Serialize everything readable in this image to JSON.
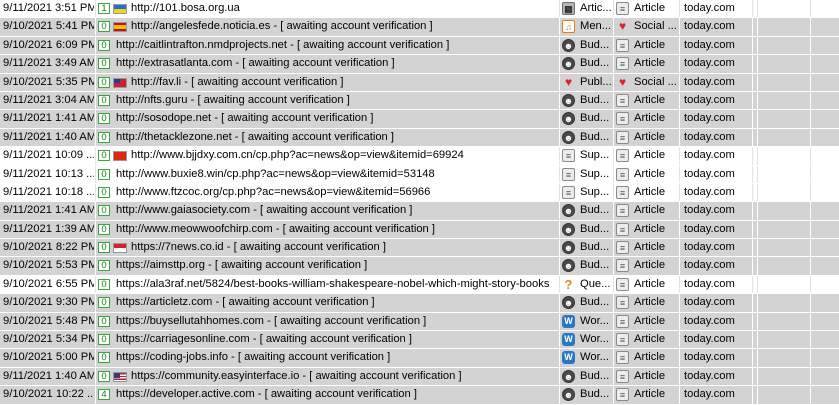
{
  "rows": [
    {
      "date": "9/11/2021 3:51 PM",
      "count": "1",
      "flag": "ua",
      "url": "http://101.bosa.org.ua",
      "topic_icon": "chip-icon",
      "topic": "Artic...",
      "page_icon": "doc-icon",
      "page_type": "Article",
      "site": "today.com",
      "shade": "white"
    },
    {
      "date": "9/10/2021 5:41 PM",
      "count": "0",
      "flag": "es",
      "url": "http://angelesfede.noticia.es - [ awaiting account verification ]",
      "topic_icon": "media-icon",
      "topic": "Men...",
      "page_icon": "social-icon",
      "page_type": "Social ...",
      "site": "today.com",
      "shade": "gray"
    },
    {
      "date": "9/10/2021 6:09 PM",
      "count": "0",
      "flag": "",
      "url": "http://caitlintrafton.nmdprojects.net - [ awaiting account verification ]",
      "topic_icon": "user-icon",
      "topic": "Bud...",
      "page_icon": "doc-icon",
      "page_type": "Article",
      "site": "today.com",
      "shade": "gray"
    },
    {
      "date": "9/11/2021 3:49 AM",
      "count": "0",
      "flag": "",
      "url": "http://extrasatlanta.com - [ awaiting account verification ]",
      "topic_icon": "user-icon",
      "topic": "Bud...",
      "page_icon": "doc-icon",
      "page_type": "Article",
      "site": "today.com",
      "shade": "gray"
    },
    {
      "date": "9/10/2021 5:35 PM",
      "count": "0",
      "flag": "tw",
      "url": "http://fav.li - [ awaiting account verification ]",
      "topic_icon": "heart-icon",
      "topic": "Publ...",
      "page_icon": "social-icon",
      "page_type": "Social ...",
      "site": "today.com",
      "shade": "gray"
    },
    {
      "date": "9/11/2021 3:04 AM",
      "count": "0",
      "flag": "",
      "url": "http://nfts.guru - [ awaiting account verification ]",
      "topic_icon": "user-icon",
      "topic": "Bud...",
      "page_icon": "doc-icon",
      "page_type": "Article",
      "site": "today.com",
      "shade": "gray"
    },
    {
      "date": "9/11/2021 1:41 AM",
      "count": "0",
      "flag": "",
      "url": "http://sosodope.net - [ awaiting account verification ]",
      "topic_icon": "user-icon",
      "topic": "Bud...",
      "page_icon": "doc-icon",
      "page_type": "Article",
      "site": "today.com",
      "shade": "gray"
    },
    {
      "date": "9/11/2021 1:40 AM",
      "count": "0",
      "flag": "",
      "url": "http://thetacklezone.net - [ awaiting account verification ]",
      "topic_icon": "user-icon",
      "topic": "Bud...",
      "page_icon": "doc-icon",
      "page_type": "Article",
      "site": "today.com",
      "shade": "gray"
    },
    {
      "date": "9/11/2021 10:09 ...",
      "count": "0",
      "flag": "cn",
      "url": "http://www.bjjdxy.com.cn/cp.php?ac=news&op=view&itemid=69924",
      "topic_icon": "doc-icon",
      "topic": "Sup...",
      "page_icon": "doc-icon",
      "page_type": "Article",
      "site": "today.com",
      "shade": "white"
    },
    {
      "date": "9/11/2021 10:13 ...",
      "count": "0",
      "flag": "",
      "url": "http://www.buxie8.win/cp.php?ac=news&op=view&itemid=53148",
      "topic_icon": "doc-icon",
      "topic": "Sup...",
      "page_icon": "doc-icon",
      "page_type": "Article",
      "site": "today.com",
      "shade": "white"
    },
    {
      "date": "9/11/2021 10:18 ...",
      "count": "0",
      "flag": "",
      "url": "http://www.ftzcoc.org/cp.php?ac=news&op=view&itemid=56966",
      "topic_icon": "doc-icon",
      "topic": "Sup...",
      "page_icon": "doc-icon",
      "page_type": "Article",
      "site": "today.com",
      "shade": "white"
    },
    {
      "date": "9/11/2021 1:41 AM",
      "count": "0",
      "flag": "",
      "url": "http://www.gaiasociety.com - [ awaiting account verification ]",
      "topic_icon": "user-icon",
      "topic": "Bud...",
      "page_icon": "doc-icon",
      "page_type": "Article",
      "site": "today.com",
      "shade": "gray"
    },
    {
      "date": "9/11/2021 1:39 AM",
      "count": "0",
      "flag": "",
      "url": "http://www.meowwoofchirp.com - [ awaiting account verification ]",
      "topic_icon": "user-icon",
      "topic": "Bud...",
      "page_icon": "doc-icon",
      "page_type": "Article",
      "site": "today.com",
      "shade": "gray"
    },
    {
      "date": "9/10/2021 8:22 PM",
      "count": "0",
      "flag": "id",
      "url": "https://7news.co.id - [ awaiting account verification ]",
      "topic_icon": "user-icon",
      "topic": "Bud...",
      "page_icon": "doc-icon",
      "page_type": "Article",
      "site": "today.com",
      "shade": "gray"
    },
    {
      "date": "9/10/2021 5:53 PM",
      "count": "0",
      "flag": "",
      "url": "https://aimsttp.org - [ awaiting account verification ]",
      "topic_icon": "user-icon",
      "topic": "Bud...",
      "page_icon": "doc-icon",
      "page_type": "Article",
      "site": "today.com",
      "shade": "gray"
    },
    {
      "date": "9/10/2021 6:55 PM",
      "count": "0",
      "flag": "",
      "url": "https://ala3raf.net/5824/best-books-william-shakespeare-nobel-which-might-story-books",
      "topic_icon": "question-icon",
      "topic": "Que...",
      "page_icon": "doc-icon",
      "page_type": "Article",
      "site": "today.com",
      "shade": "white"
    },
    {
      "date": "9/10/2021 9:30 PM",
      "count": "0",
      "flag": "",
      "url": "https://articletz.com - [ awaiting account verification ]",
      "topic_icon": "user-icon",
      "topic": "Bud...",
      "page_icon": "doc-icon",
      "page_type": "Article",
      "site": "today.com",
      "shade": "gray"
    },
    {
      "date": "9/10/2021 5:48 PM",
      "count": "0",
      "flag": "",
      "url": "https://buysellutahhomes.com - [ awaiting account verification ]",
      "topic_icon": "wordpress-icon",
      "topic": "Wor...",
      "page_icon": "doc-icon",
      "page_type": "Article",
      "site": "today.com",
      "shade": "gray"
    },
    {
      "date": "9/10/2021 5:34 PM",
      "count": "0",
      "flag": "",
      "url": "https://carriagesonline.com - [ awaiting account verification ]",
      "topic_icon": "wordpress-icon",
      "topic": "Wor...",
      "page_icon": "doc-icon",
      "page_type": "Article",
      "site": "today.com",
      "shade": "gray"
    },
    {
      "date": "9/10/2021 5:00 PM",
      "count": "0",
      "flag": "",
      "url": "https://coding-jobs.info - [ awaiting account verification ]",
      "topic_icon": "wordpress-icon",
      "topic": "Wor...",
      "page_icon": "doc-icon",
      "page_type": "Article",
      "site": "today.com",
      "shade": "gray"
    },
    {
      "date": "9/11/2021 1:40 AM",
      "count": "0",
      "flag": "us",
      "url": "https://community.easyinterface.io - [ awaiting account verification ]",
      "topic_icon": "user-icon",
      "topic": "Bud...",
      "page_icon": "doc-icon",
      "page_type": "Article",
      "site": "today.com",
      "shade": "gray"
    },
    {
      "date": "9/10/2021 10:22 ...",
      "count": "4",
      "flag": "",
      "url": "https://developer.active.com - [ awaiting account verification ]",
      "topic_icon": "user-icon",
      "topic": "Bud...",
      "page_icon": "doc-icon",
      "page_type": "Article",
      "site": "today.com",
      "shade": "gray"
    }
  ]
}
